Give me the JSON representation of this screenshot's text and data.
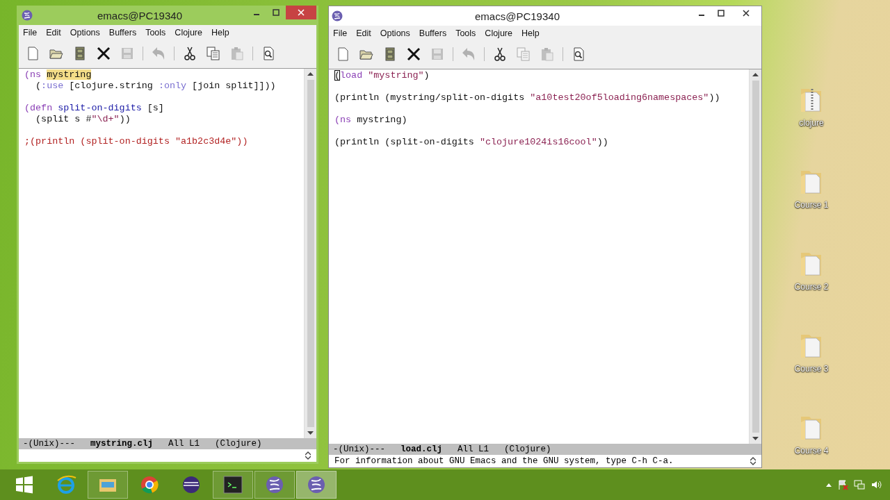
{
  "windows": [
    {
      "title": "emacs@PC19340",
      "active": true,
      "menu": [
        "File",
        "Edit",
        "Options",
        "Buffers",
        "Tools",
        "Clojure",
        "Help"
      ],
      "toolbar": [
        {
          "kind": "new",
          "disabled": false
        },
        {
          "kind": "open",
          "disabled": false
        },
        {
          "kind": "cabinet",
          "disabled": false
        },
        {
          "kind": "close",
          "disabled": false
        },
        {
          "kind": "save",
          "disabled": true
        },
        {
          "kind": "separator"
        },
        {
          "kind": "undo",
          "disabled": true
        },
        {
          "kind": "separator"
        },
        {
          "kind": "cut",
          "disabled": false
        },
        {
          "kind": "copy",
          "disabled": false
        },
        {
          "kind": "paste",
          "disabled": true
        },
        {
          "kind": "separator"
        },
        {
          "kind": "search",
          "disabled": false
        }
      ],
      "forms": [
        {
          "lines": [
            [
              {
                "kind": "keyword",
                "text": "(ns "
              },
              {
                "kind": "highlight",
                "text": "mystring"
              }
            ],
            [
              {
                "kind": "plain",
                "text": "  ("
              },
              {
                "kind": "constant",
                "text": ":use"
              },
              {
                "kind": "plain",
                "text": " [clojure.string "
              },
              {
                "kind": "constant",
                "text": ":only"
              },
              {
                "kind": "plain",
                "text": " [join split]]))"
              }
            ]
          ]
        },
        {
          "lines": [
            [
              {
                "kind": "keyword",
                "text": "(defn "
              },
              {
                "kind": "function",
                "text": "split-on-digits"
              },
              {
                "kind": "plain",
                "text": " [s]"
              }
            ],
            [
              {
                "kind": "plain",
                "text": "  (split s #"
              },
              {
                "kind": "string",
                "text": "\"\\d+\""
              },
              {
                "kind": "plain",
                "text": "))"
              }
            ]
          ]
        },
        {
          "lines": [
            [
              {
                "kind": "comment",
                "text": ";(println (split-on-digits \"a1b2c3d4e\"))"
              }
            ]
          ]
        }
      ],
      "mode_line": {
        "status": "-(Unix)---",
        "buffer": "mystring.clj",
        "position": "All L1",
        "mode": "(Clojure)"
      }
    },
    {
      "title": "emacs@PC19340",
      "active": false,
      "menu": [
        "File",
        "Edit",
        "Options",
        "Buffers",
        "Tools",
        "Clojure",
        "Help"
      ],
      "toolbar": [
        {
          "kind": "new",
          "disabled": false
        },
        {
          "kind": "open",
          "disabled": false
        },
        {
          "kind": "cabinet",
          "disabled": false
        },
        {
          "kind": "close",
          "disabled": false
        },
        {
          "kind": "save",
          "disabled": true
        },
        {
          "kind": "separator"
        },
        {
          "kind": "undo",
          "disabled": true
        },
        {
          "kind": "separator"
        },
        {
          "kind": "cut",
          "disabled": false
        },
        {
          "kind": "copy",
          "disabled": true
        },
        {
          "kind": "paste",
          "disabled": true
        },
        {
          "kind": "separator"
        },
        {
          "kind": "search",
          "disabled": false
        }
      ],
      "forms": [
        {
          "lines": [
            [
              {
                "kind": "cursor",
                "text": "("
              },
              {
                "kind": "keyword",
                "text": "load "
              },
              {
                "kind": "string",
                "text": "\"mystring\""
              },
              {
                "kind": "plain",
                "text": ")"
              }
            ]
          ]
        },
        {
          "lines": [
            [
              {
                "kind": "plain",
                "text": "(println (mystring/split-on-digits "
              },
              {
                "kind": "string",
                "text": "\"a10test20of5loading6namespaces\""
              },
              {
                "kind": "plain",
                "text": "))"
              }
            ]
          ]
        },
        {
          "lines": [
            [
              {
                "kind": "keyword",
                "text": "(ns "
              },
              {
                "kind": "plain",
                "text": "mystring)"
              }
            ]
          ]
        },
        {
          "lines": [
            [
              {
                "kind": "plain",
                "text": "(println (split-on-digits "
              },
              {
                "kind": "string",
                "text": "\"clojure1024is16cool\""
              },
              {
                "kind": "plain",
                "text": "))"
              }
            ]
          ]
        }
      ],
      "mode_line": {
        "status": "-(Unix)---",
        "buffer": "load.clj",
        "position": "All L1",
        "mode": "(Clojure)"
      },
      "echo": "For information about GNU Emacs and the GNU system, type C-h C-a."
    }
  ],
  "desktop_icons": [
    {
      "kind": "zip",
      "label": "clojure"
    },
    {
      "kind": "folder",
      "label": "Course 1"
    },
    {
      "kind": "folder",
      "label": "Course 2"
    },
    {
      "kind": "folder",
      "label": "Course 3"
    },
    {
      "kind": "folder",
      "label": "Course 4"
    }
  ],
  "taskbar": [
    {
      "kind": "start",
      "running": false,
      "selected": false
    },
    {
      "kind": "browser-e",
      "running": false,
      "selected": false
    },
    {
      "kind": "files",
      "running": true,
      "selected": false
    },
    {
      "kind": "chrome",
      "running": false,
      "selected": false
    },
    {
      "kind": "eclipse",
      "running": false,
      "selected": false
    },
    {
      "kind": "terminal",
      "running": true,
      "selected": false
    },
    {
      "kind": "emacs",
      "running": true,
      "selected": false
    },
    {
      "kind": "emacs",
      "running": true,
      "selected": true
    }
  ]
}
